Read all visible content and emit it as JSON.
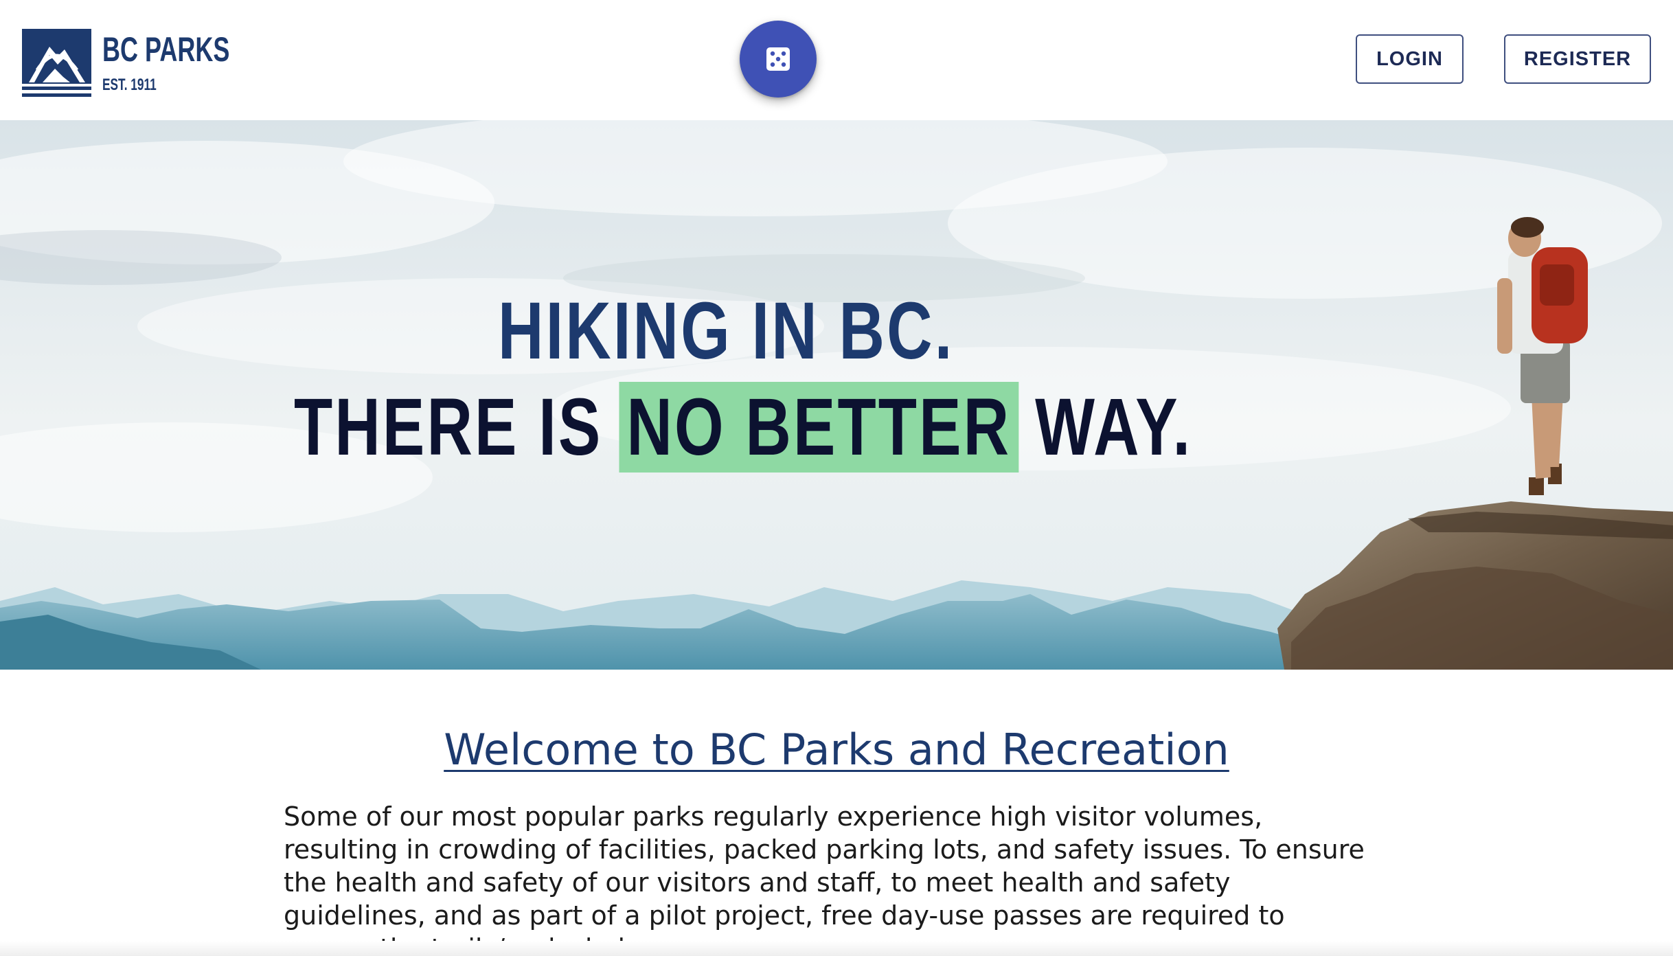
{
  "header": {
    "brand_name": "BC PARKS",
    "brand_est": "EST. 1911",
    "random_button_icon": "dice-five-icon",
    "login_label": "LOGIN",
    "register_label": "REGISTER"
  },
  "hero": {
    "line1": "HIKING IN BC.",
    "line2_prefix": "THERE IS ",
    "line2_highlight": "NO BETTER",
    "line2_suffix": " WAY."
  },
  "welcome": {
    "title": "Welcome to BC Parks and Recreation",
    "body": "Some of our most popular parks regularly experience high visitor volumes, resulting in crowding of facilities, packed parking lots, and safety issues. To ensure the health and safety of our visitors and staff, to meet health and safety guidelines, and as part of a pilot project, free day-use passes are required to access the trails/parks below."
  },
  "colors": {
    "brand_navy": "#1d3a6e",
    "fab_indigo": "#3f51b5",
    "highlight_green": "#8ed9a3"
  }
}
